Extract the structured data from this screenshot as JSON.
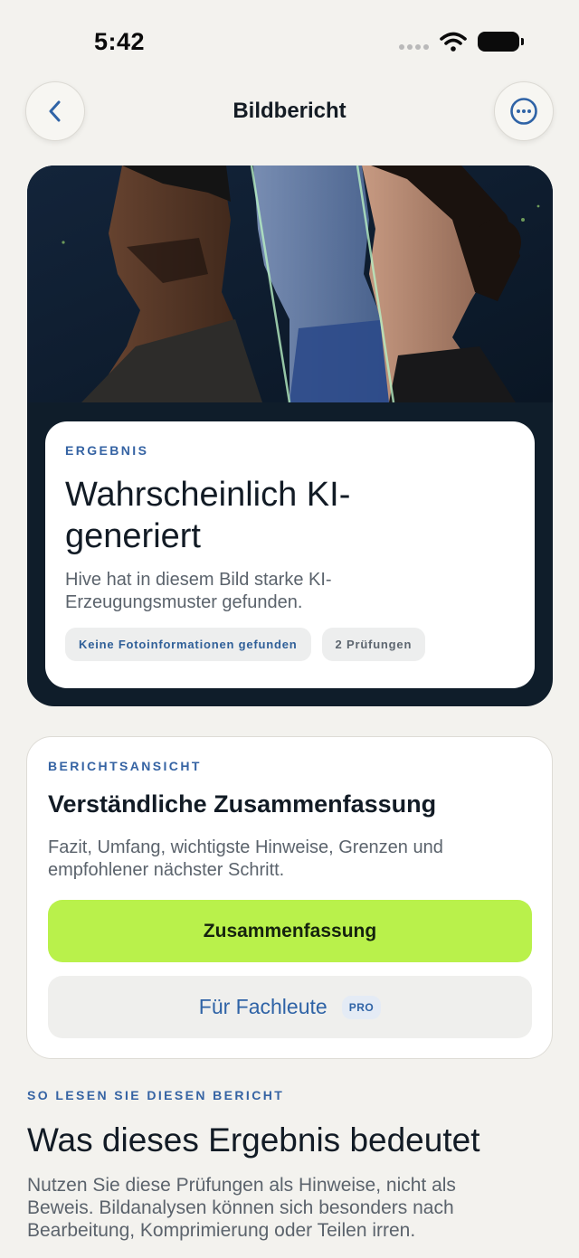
{
  "status_bar": {
    "time": "5:42"
  },
  "nav": {
    "title": "Bildbericht",
    "back_icon": "chevron-left-icon",
    "more_icon": "more-horizontal-icon"
  },
  "result": {
    "eyebrow": "ERGEBNIS",
    "title": "Wahrscheinlich KI-generiert",
    "description": "Hive hat in diesem Bild starke KI-Erzeugungsmuster gefunden.",
    "chips": [
      "Keine Fotoinformationen gefunden",
      "2 Prüfungen"
    ]
  },
  "report": {
    "eyebrow": "BERICHTSANSICHT",
    "title": "Verständliche Zusammenfassung",
    "description": "Fazit, Umfang, wichtigste Hinweise, Grenzen und empfohlener nächster Schritt.",
    "primary_button": "Zusammenfassung",
    "secondary_button": "Für Fachleute",
    "secondary_badge": "PRO"
  },
  "info": {
    "eyebrow": "SO LESEN SIE DIESEN BERICHT",
    "title": "Was dieses Ergebnis bedeutet",
    "description": "Nutzen Sie diese Prüfungen als Hinweise, nicht als Beweis. Bildanalysen können sich besonders nach Bearbeitung, Komprimierung oder Teilen irren."
  },
  "colors": {
    "background": "#f3f2ee",
    "hero_dark": "#0f1d2a",
    "accent_blue": "#3563a3",
    "primary_button": "#b9f14b"
  }
}
